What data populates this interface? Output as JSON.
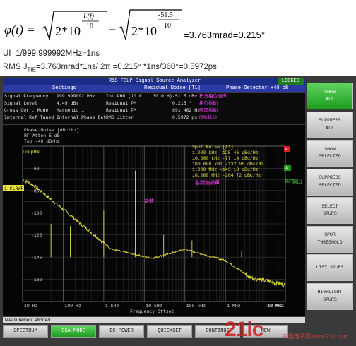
{
  "formula": {
    "lhs": "φ(t) =",
    "sqrt1": "2*10",
    "exp1_num": "L(f)",
    "exp1_den": "10",
    "eq": "=",
    "sqrt2": "2*10",
    "exp2_num": "-51.5",
    "exp2_den": "10",
    "result": "=3.763mrad=0.215°"
  },
  "lines": {
    "ui": "UI=1/999.999992MHz≈1ns",
    "rms_prefix": "RMS J",
    "rms_sub": "TIE",
    "rms_rest": "=3.763mrad*1ns/ 2π =0.215° *1ns/360°=0.5972ps"
  },
  "analyzer": {
    "title": "R&S FSUP Signal Source Analyzer",
    "locked": "LOCKED",
    "headers": {
      "settings": "Settings",
      "residual": "Residual Noise [T1]",
      "detector": "Phase Detector +40 dB"
    },
    "rows": [
      {
        "label": "Signal Frequency",
        "value": "999.999992 MHz",
        "rlabel": "Int PHN (10.0 .. 30.0 M)",
        "rvalue": "-51.5 dBc",
        "note": "积分相位噪声"
      },
      {
        "label": "Signal Level",
        "value": "4.49 dBm",
        "rlabel": "Residual PM",
        "rvalue": "0.215 °",
        "note": "相位抖动"
      },
      {
        "label": "Cross Corr. Mode",
        "value": "Harmonic 1",
        "rlabel": "Residual FM",
        "rvalue": "891.462 Hz",
        "note": "频率抖动"
      },
      {
        "label": "Internal Ref Tuned",
        "value": "Internal Phase Det",
        "rlabel": "RMS Jitter",
        "rvalue": "0.5972 ps",
        "note": "RMS抖动"
      }
    ],
    "plot_info": {
      "title": "Phase Noise [dBc/Hz]",
      "atten": "RF Atten    5 dB",
      "top": "Top -40 dB/Hz",
      "loop": "LoopBW",
      "clrwr": "1 CLRWR",
      "note_spur": "杂散",
      "note_rf": "RF输出",
      "marker_a": "A"
    },
    "spot_noise": {
      "title": "Spot Noise    [T1]",
      "rows": [
        "1.000 kHz   -125.46 dBc/Hz",
        "10.000 kHz   -77.14 dBc/Hz",
        "100.000 kHz -132.96 dBc/Hz",
        "1.000 MHz   -143.18 dBc/Hz",
        "10.000 MHz  -164.72 dBc/Hz"
      ],
      "label": "各频偏噪声"
    },
    "x_ticks": [
      "10 Hz",
      "100 Hz",
      "1 kHz",
      "10 kHz",
      "100 kHz",
      "1 MHz",
      "10 MHz",
      "30 MHz"
    ],
    "y_ticks": [
      "-60",
      "-80",
      "-100",
      "-120",
      "-140",
      "-160"
    ],
    "x_axis_label": "Frequency Offset",
    "status": "Measurement Aborted",
    "softkeys": [
      {
        "label": "SHOW\nALL",
        "active": true
      },
      {
        "label": "SUPPRESS\nALL",
        "active": false
      },
      {
        "label": "SHOW\nSELECTED",
        "active": false
      },
      {
        "label": "SUPPRESS\nSELECTED",
        "active": false
      },
      {
        "label": "SELECT\nSPURS",
        "active": false
      },
      {
        "label": "SPUR\nTHRESHOLD",
        "active": false
      },
      {
        "label": "LIST SPURS",
        "active": false
      },
      {
        "label": "HIGHLIGHT\nSPURS",
        "active": false
      }
    ],
    "bottom_keys": [
      {
        "label": "SPECTRUM",
        "active": false
      },
      {
        "label": "SSA MODE",
        "active": true
      },
      {
        "label": "DC POWER",
        "active": false
      },
      {
        "label": "QUICKSET",
        "active": false
      },
      {
        "label": "CONTINUE",
        "active": false
      },
      {
        "label": "NEW",
        "active": false
      }
    ]
  },
  "watermark": {
    "main": "21ic",
    "sub": "中国电子网 www.21ic.com"
  },
  "colors": {
    "trace": "#e8e23a",
    "grid": "#3b3b3b",
    "accent": "#1b2d86"
  }
}
